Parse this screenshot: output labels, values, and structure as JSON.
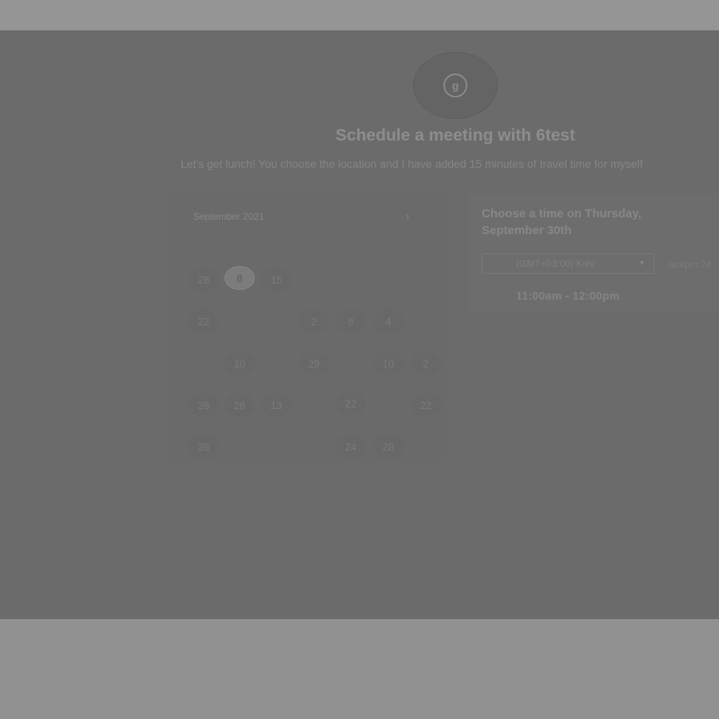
{
  "header": {
    "title": "Schedule a meeting with 6test",
    "description": "Let's get lunch! You choose the location and I have added 15 minutes of travel time for myself"
  },
  "avatar": {
    "initials": "g"
  },
  "calendar": {
    "month_label": "September 2021",
    "next_icon": "chevron-right-icon",
    "days": [
      {
        "label": "28"
      },
      {
        "label": "8"
      },
      {
        "label": "15"
      },
      {
        "label": "22"
      },
      {
        "label": "2"
      },
      {
        "label": "8"
      },
      {
        "label": "4"
      },
      {
        "label": "10"
      },
      {
        "label": "29"
      },
      {
        "label": "10"
      },
      {
        "label": "2"
      },
      {
        "label": "28"
      },
      {
        "label": "28"
      },
      {
        "label": "13"
      },
      {
        "label": "22"
      },
      {
        "label": "22"
      },
      {
        "label": "26"
      },
      {
        "label": "24"
      },
      {
        "label": "28"
      }
    ],
    "selected_index": 1
  },
  "times": {
    "heading": "Choose a time on Thursday, September 30th",
    "timezone": "(GMT+03:00) Kiev",
    "time_format": "am/pm  24",
    "slots": [
      "11:00am - 12:00pm"
    ]
  }
}
